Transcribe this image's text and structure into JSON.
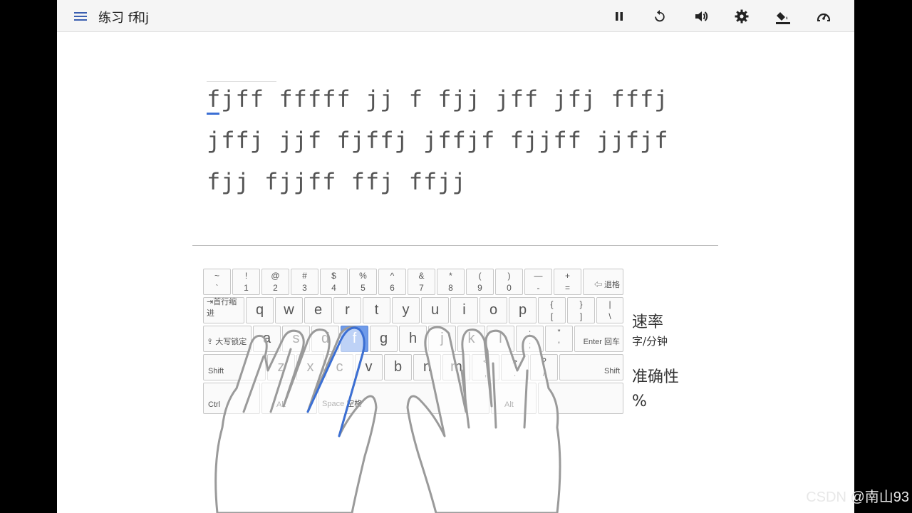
{
  "header": {
    "title": "练习 f和j"
  },
  "text_lines": [
    "fjff fffff jj f fjj jff jfj fffj",
    "jffj jjf fjffj jffjf fjjff jjfjf",
    "fjj fjjff ffj ffjj"
  ],
  "keyboard": {
    "row1": [
      {
        "top": "~",
        "bot": "`"
      },
      {
        "top": "!",
        "bot": "1"
      },
      {
        "top": "@",
        "bot": "2"
      },
      {
        "top": "#",
        "bot": "3"
      },
      {
        "top": "$",
        "bot": "4"
      },
      {
        "top": "%",
        "bot": "5"
      },
      {
        "top": "^",
        "bot": "6"
      },
      {
        "top": "&",
        "bot": "7"
      },
      {
        "top": "*",
        "bot": "8"
      },
      {
        "top": "(",
        "bot": "9"
      },
      {
        "top": ")",
        "bot": "0"
      },
      {
        "top": "—",
        "bot": "-"
      },
      {
        "top": "+",
        "bot": "="
      }
    ],
    "backspace": "⇦ 退格",
    "tab": "⇥首行缩进",
    "row2": [
      "q",
      "w",
      "e",
      "r",
      "t",
      "y",
      "u",
      "i",
      "o",
      "p"
    ],
    "row2_sym": [
      {
        "top": "{",
        "bot": "["
      },
      {
        "top": "}",
        "bot": "]"
      },
      {
        "top": "|",
        "bot": "\\"
      }
    ],
    "caps": "⇪ 大写锁定",
    "row3": [
      "a",
      "s",
      "d",
      "f",
      "g",
      "h",
      "j",
      "k",
      "l"
    ],
    "row3_sym": [
      {
        "top": ":",
        "bot": ";"
      },
      {
        "top": "\"",
        "bot": "'"
      }
    ],
    "enter": "Enter 回车",
    "shift_left": "Shift",
    "row4": [
      "z",
      "x",
      "c",
      "v",
      "b",
      "n",
      "m"
    ],
    "row4_sym": [
      {
        "top": "<",
        "bot": ","
      },
      {
        "top": ">",
        "bot": "."
      },
      {
        "top": "?",
        "bot": "/"
      }
    ],
    "shift_right": "Shift",
    "ctrl": "Ctrl",
    "alt_left": "Alt",
    "space": "Space 空格",
    "alt_right": "Alt",
    "highlight_key": "f"
  },
  "stats": {
    "speed_label": "速率",
    "speed_unit": "字/分钟",
    "accuracy_label": "准确性",
    "accuracy_unit": "%"
  },
  "watermark": "CSDN @南山93",
  "colors": {
    "accent": "#3b6fd4",
    "highlight": "#6f9bea"
  }
}
